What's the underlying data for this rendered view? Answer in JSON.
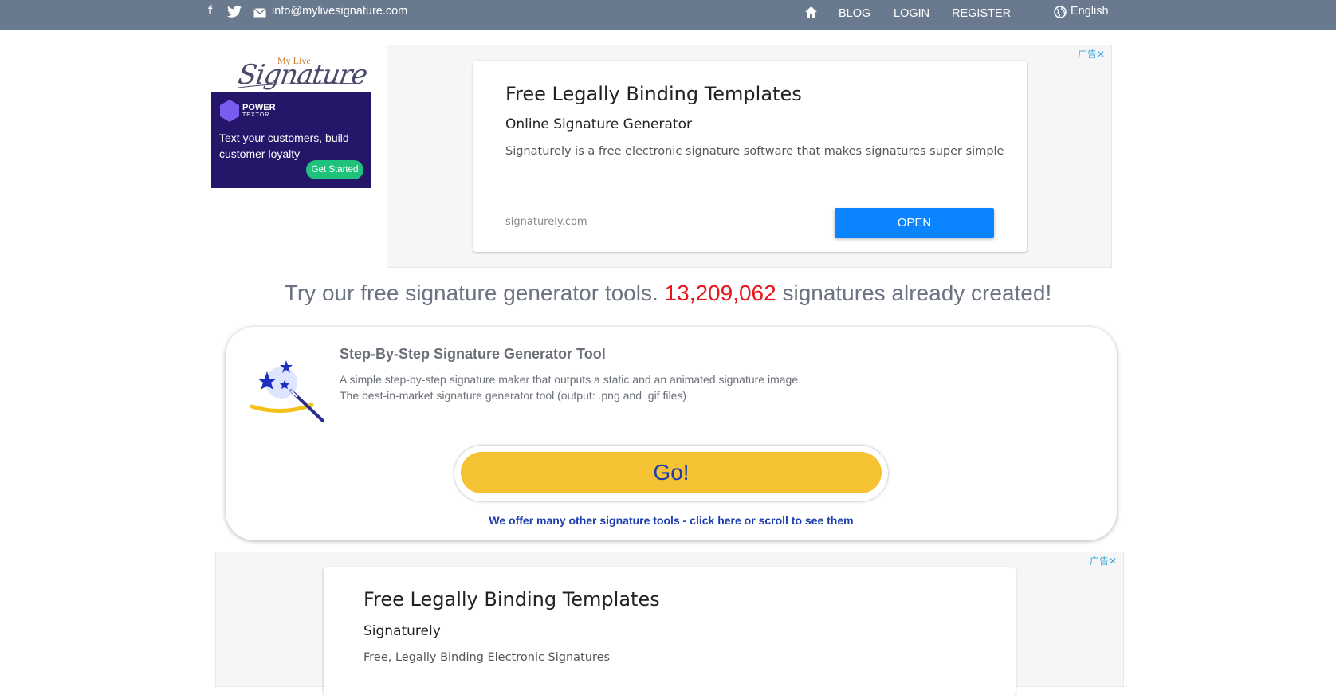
{
  "topbar": {
    "facebook_icon": "f",
    "twitter_icon": "🐦",
    "email": "info@mylivesignature.com",
    "home_icon": "⌂",
    "nav": [
      "BLOG",
      "LOGIN",
      "REGISTER"
    ],
    "language": "English"
  },
  "logo": {
    "top": "My Live",
    "main": "Signature"
  },
  "side_ad": {
    "brand": "POWER",
    "brand_sub": "TEXTOR",
    "text": "Text your customers, build customer loyalty",
    "button": "Get Started"
  },
  "ad_top": {
    "badge": "广告✕",
    "title": "Free Legally Binding Templates",
    "subtitle": "Online Signature Generator",
    "description": "Signaturely is a free electronic signature software that makes signatures super simple",
    "url": "signaturely.com",
    "button": "OPEN"
  },
  "headline": {
    "before": "Try our free signature generator tools. ",
    "count": "13,209,062",
    "after": " signatures already created!"
  },
  "tool": {
    "title": "Step-By-Step Signature Generator Tool",
    "desc_line1": "A simple step-by-step signature maker that outputs a static and an animated signature image.",
    "desc_line2": "The best-in-market signature generator tool (output: .png and .gif files)",
    "go_button": "Go!",
    "more_link": "We offer many other signature tools - click here or scroll to see them"
  },
  "ad_bottom": {
    "badge": "广告✕",
    "title": "Free Legally Binding Templates",
    "subtitle": "Signaturely",
    "description": "Free, Legally Binding Electronic Signatures"
  },
  "colors": {
    "topbar": "#6a7a8e",
    "count": "#e8141c",
    "go_button": "#f4c232",
    "open_button": "#0a84ff",
    "link": "#1a3db0"
  }
}
